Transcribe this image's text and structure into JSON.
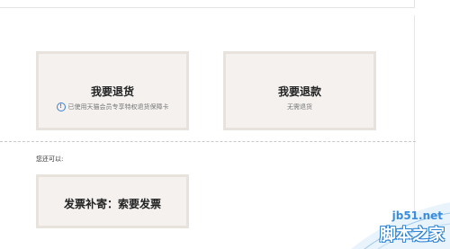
{
  "options": {
    "return_goods": {
      "title": "我要退货",
      "note": "已使用天猫会员专享特权退货保障卡"
    },
    "refund": {
      "title": "我要退款",
      "note": "无需退货"
    }
  },
  "more": {
    "label": "您还可以:",
    "invoice_title": "发票补寄：索要发票"
  },
  "watermark": {
    "url": "jb51.net",
    "name": "脚本之家"
  },
  "colors": {
    "card_border": "#e8e2dd",
    "card_bg": "#f4f1ef",
    "info_icon": "#3b7fd4",
    "watermark_blue": "#2d84d6"
  },
  "icons": {
    "info": "info-icon"
  }
}
